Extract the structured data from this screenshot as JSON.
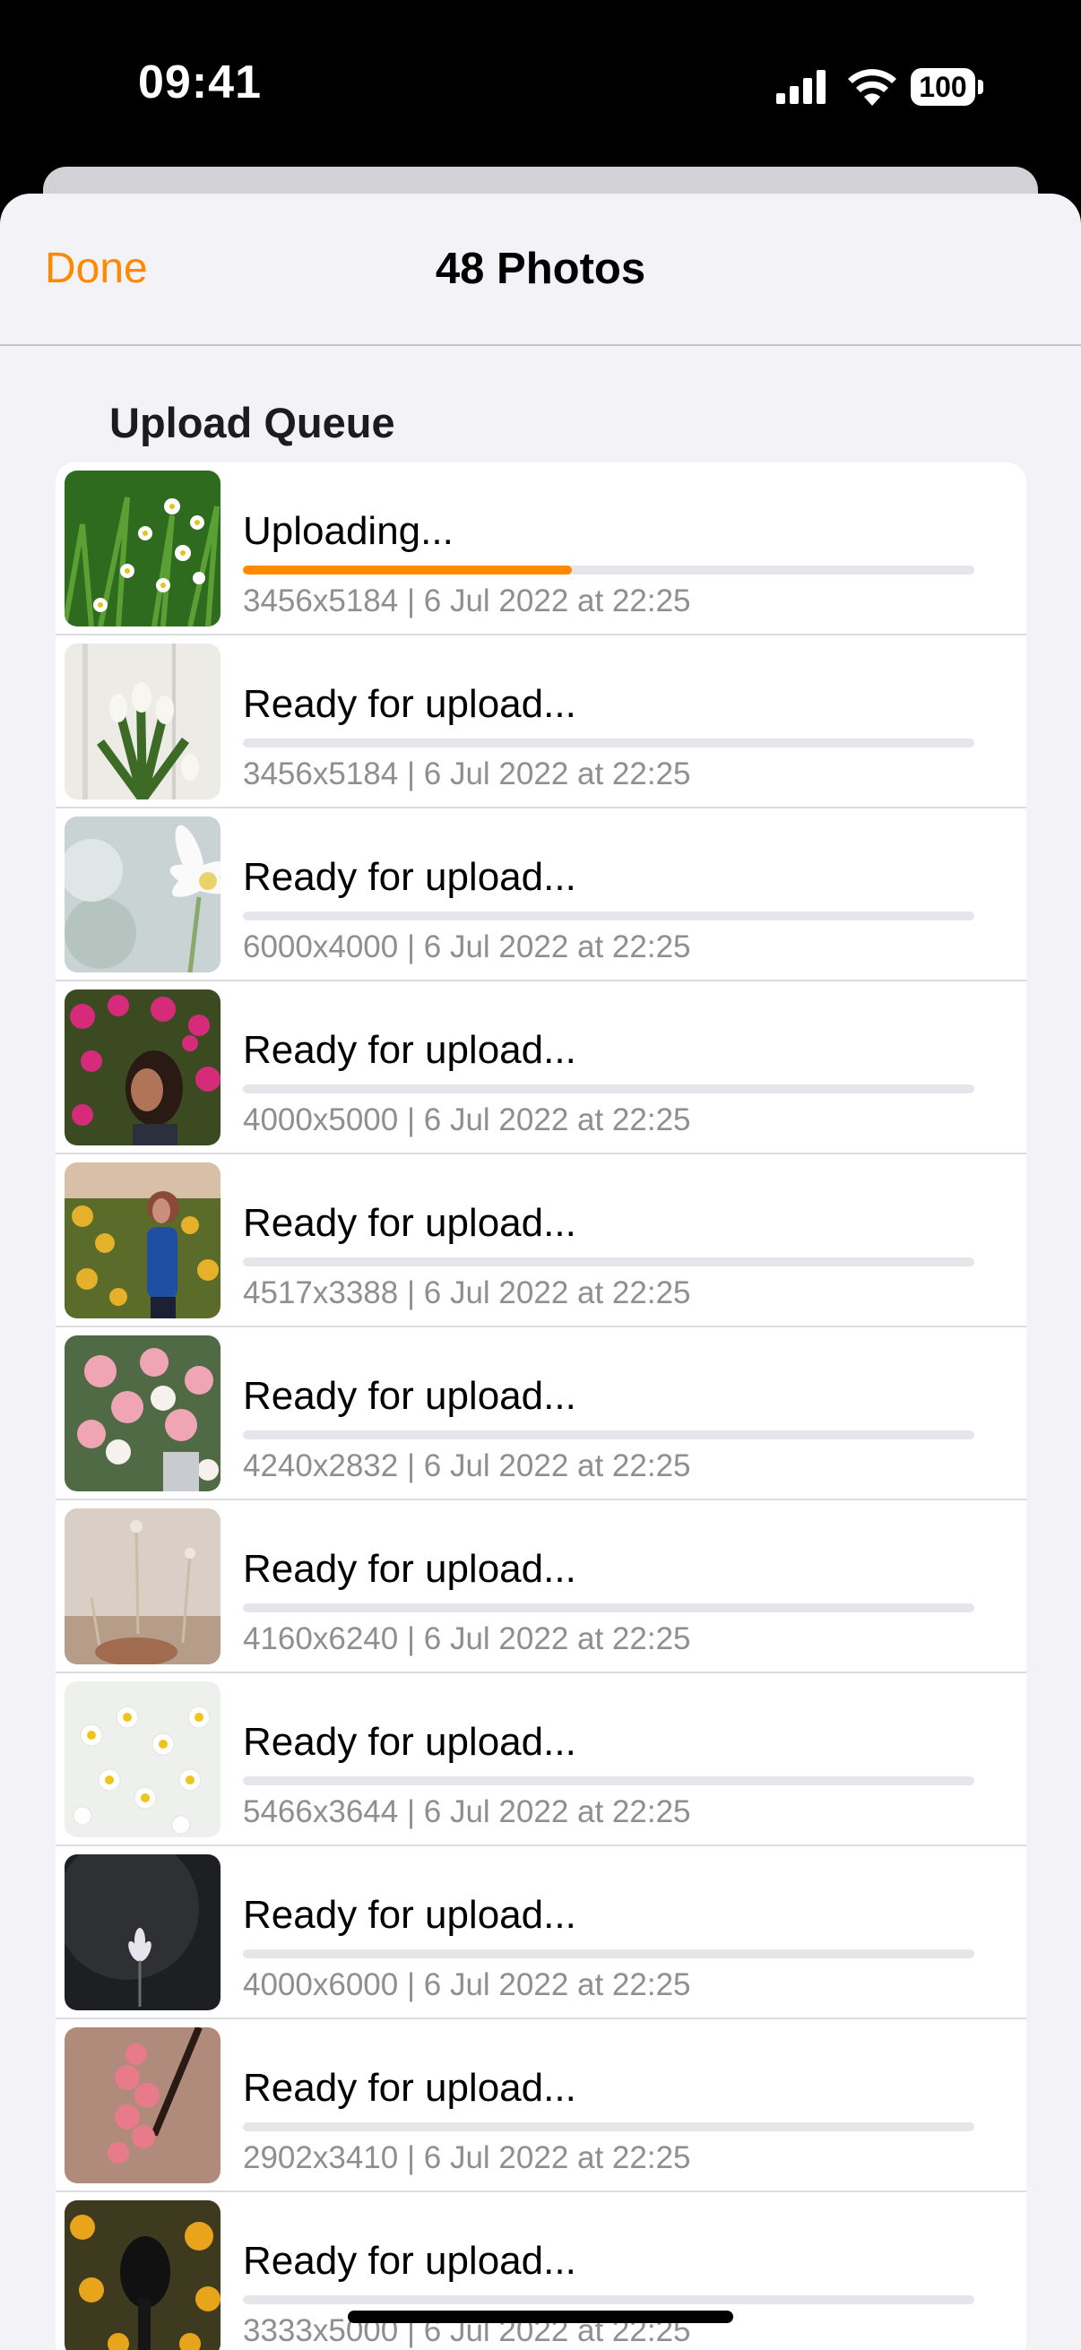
{
  "status_bar": {
    "time": "09:41",
    "battery": "100"
  },
  "navbar": {
    "done_label": "Done",
    "title": "48 Photos"
  },
  "section": {
    "title": "Upload Queue"
  },
  "colors": {
    "accent": "#ff8a00",
    "track": "#e5e5ea",
    "secondary_text": "#8e8e93"
  },
  "queue": [
    {
      "status": "Uploading...",
      "meta": "3456x5184 | 6 Jul 2022 at 22:25",
      "progress": 0.45,
      "thumb": "white-daisies-on-grass"
    },
    {
      "status": "Ready for upload...",
      "meta": "3456x5184 | 6 Jul 2022 at 22:25",
      "progress": 0,
      "thumb": "white-tulips"
    },
    {
      "status": "Ready for upload...",
      "meta": "6000x4000 | 6 Jul 2022 at 22:25",
      "progress": 0,
      "thumb": "white-flower-closeup"
    },
    {
      "status": "Ready for upload...",
      "meta": "4000x5000 | 6 Jul 2022 at 22:25",
      "progress": 0,
      "thumb": "woman-with-pink-flowers"
    },
    {
      "status": "Ready for upload...",
      "meta": "4517x3388 | 6 Jul 2022 at 22:25",
      "progress": 0,
      "thumb": "woman-in-sunflower-field"
    },
    {
      "status": "Ready for upload...",
      "meta": "4240x2832 | 6 Jul 2022 at 22:25",
      "progress": 0,
      "thumb": "pink-rose-bouquet"
    },
    {
      "status": "Ready for upload...",
      "meta": "4160x6240 | 6 Jul 2022 at 22:25",
      "progress": 0,
      "thumb": "hand-with-dried-flower"
    },
    {
      "status": "Ready for upload...",
      "meta": "5466x3644 | 6 Jul 2022 at 22:25",
      "progress": 0,
      "thumb": "chamomile-flowers"
    },
    {
      "status": "Ready for upload...",
      "meta": "4000x6000 | 6 Jul 2022 at 22:25",
      "progress": 0,
      "thumb": "single-flower-dark"
    },
    {
      "status": "Ready for upload...",
      "meta": "2902x3410 | 6 Jul 2022 at 22:25",
      "progress": 0,
      "thumb": "pink-orchid"
    },
    {
      "status": "Ready for upload...",
      "meta": "3333x5000 | 6 Jul 2022 at 22:25",
      "progress": 0,
      "thumb": "woman-braid-sunflowers"
    }
  ]
}
